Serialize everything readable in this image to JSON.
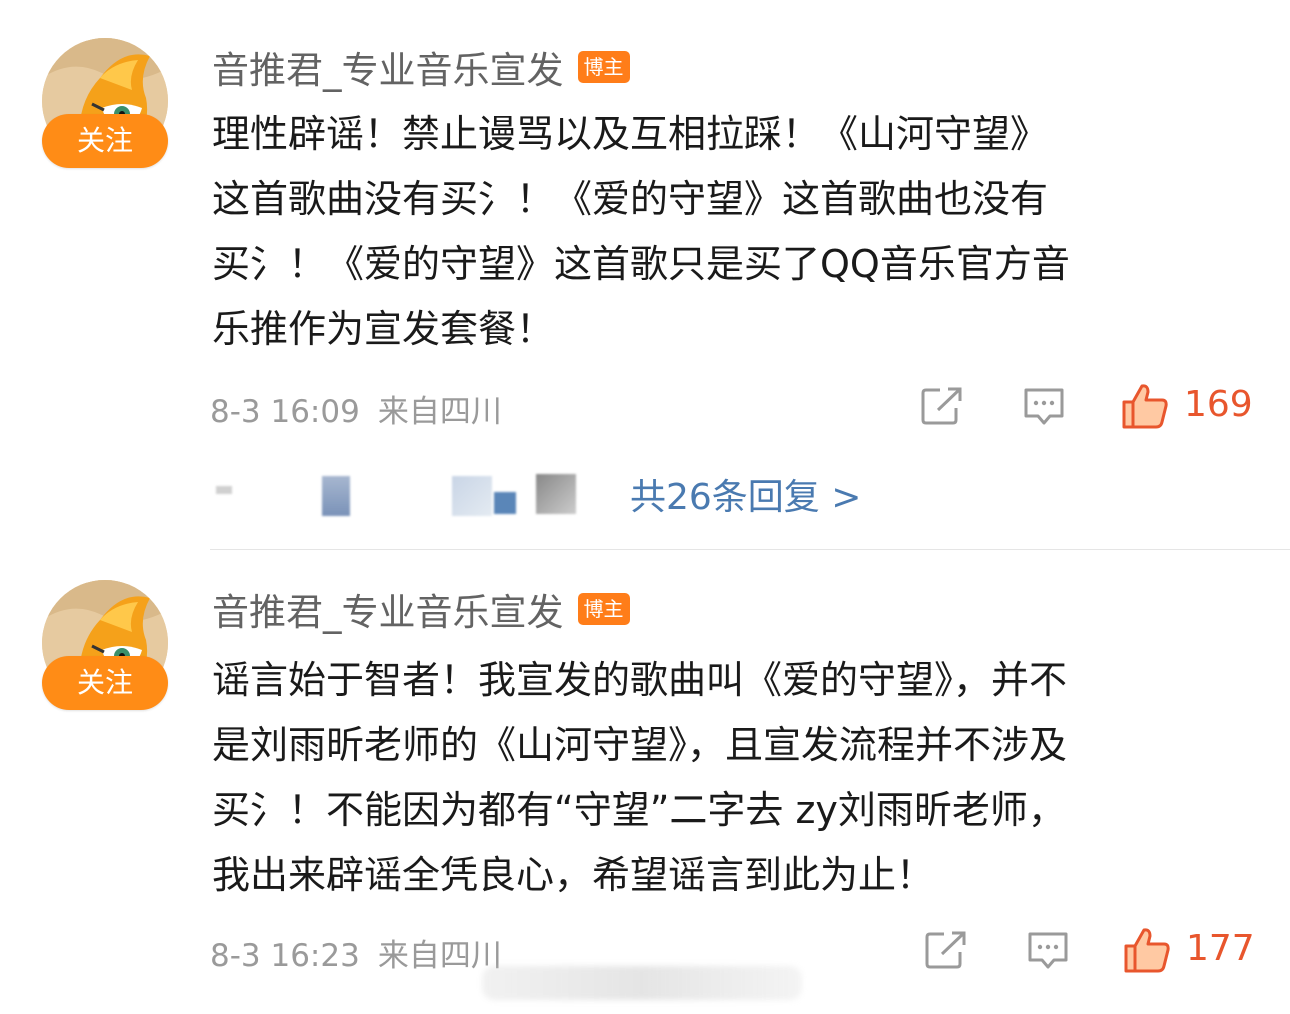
{
  "comments": [
    {
      "username": "音推君_专业音乐宣发",
      "badge": "博主",
      "follow_label": "关注",
      "text_lines": [
        "理性辟谣！禁止谩骂以及互相拉踩！《山河守望》",
        "这首歌曲没有买氵！《爱的守望》这首歌曲也没有",
        "买氵！《爱的守望》这首歌只是买了QQ音乐官方音",
        "乐推作为宣发套餐！"
      ],
      "date": "8-3 16:09",
      "location": "来自四川",
      "likes": "169",
      "replies_label": "共26条回复 >"
    },
    {
      "username": "音推君_专业音乐宣发",
      "badge": "博主",
      "follow_label": "关注",
      "text_lines": [
        "谣言始于智者！我宣发的歌曲叫《爱的守望》，并不",
        "是刘雨昕老师的《山河守望》，且宣发流程并不涉及",
        "买氵！不能因为都有“守望”二字去 zy刘雨昕老师，",
        "我出来辟谣全凭良心，希望谣言到此为止！"
      ],
      "date": "8-3 16:23",
      "location": "来自四川",
      "likes": "177"
    }
  ],
  "icons": {
    "share": "share-icon",
    "comment": "comment-icon",
    "like": "thumbs-up-icon",
    "avatar": "avatar-icon"
  },
  "colors": {
    "follow_button": "#ff8c16",
    "badge": "#ff7d19",
    "like_count": "#e8562d",
    "reply_link": "#4a7ab0",
    "meta_text": "#9a9a9a"
  }
}
